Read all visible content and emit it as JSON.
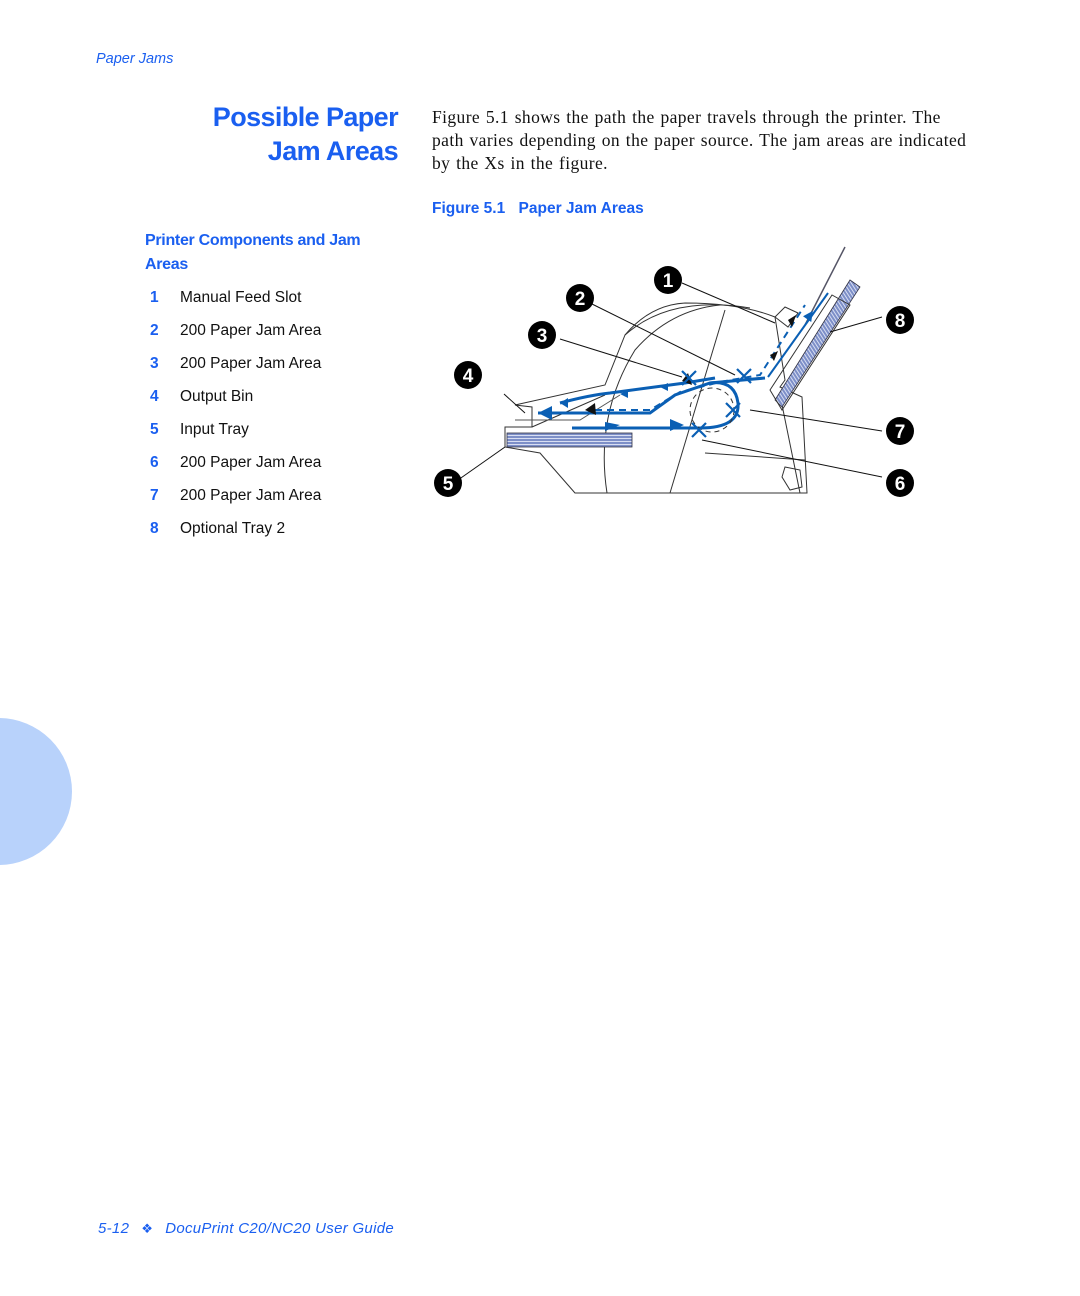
{
  "running_head": "Paper Jams",
  "section_title_lines": [
    "Possible Paper",
    "Jam Areas"
  ],
  "intro_text": "Figure 5.1 shows the path the paper travels through the printer. The path varies depending on the paper source. The jam areas are indicated by the Xs in the figure.",
  "figure": {
    "number": "Figure 5.1",
    "title": "Paper Jam Areas",
    "callouts": [
      "1",
      "2",
      "3",
      "4",
      "5",
      "6",
      "7",
      "8"
    ]
  },
  "components": {
    "heading": "Printer Components and Jam Areas",
    "items": [
      {
        "num": "1",
        "label": "Manual Feed Slot"
      },
      {
        "num": "2",
        "label": "200 Paper Jam Area"
      },
      {
        "num": "3",
        "label": "200 Paper Jam Area"
      },
      {
        "num": "4",
        "label": "Output Bin"
      },
      {
        "num": "5",
        "label": "Input Tray"
      },
      {
        "num": "6",
        "label": "200 Paper Jam Area"
      },
      {
        "num": "7",
        "label": "200 Paper Jam Area"
      },
      {
        "num": "8",
        "label": "Optional Tray 2"
      }
    ]
  },
  "footer": {
    "page": "5-12",
    "separator": "❖",
    "guide": "DocuPrint C20/NC20 User Guide"
  },
  "colors": {
    "accent": "#1a5ff0",
    "path_blue": "#0a5fb4",
    "side_tab": "#b8d2fb"
  }
}
